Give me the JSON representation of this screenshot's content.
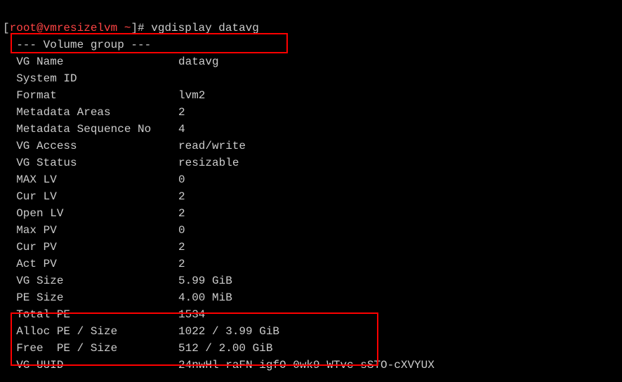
{
  "prompt": {
    "open": "[",
    "user_host": "root@vmresizelvm ~",
    "close": "]# ",
    "command": "vgdisplay datavg"
  },
  "header": "  --- Volume group ---",
  "rows": [
    {
      "label": "  VG Name",
      "value": "datavg"
    },
    {
      "label": "  System ID",
      "value": ""
    },
    {
      "label": "  Format",
      "value": "lvm2"
    },
    {
      "label": "  Metadata Areas",
      "value": "2"
    },
    {
      "label": "  Metadata Sequence No",
      "value": "4"
    },
    {
      "label": "  VG Access",
      "value": "read/write"
    },
    {
      "label": "  VG Status",
      "value": "resizable"
    },
    {
      "label": "  MAX LV",
      "value": "0"
    },
    {
      "label": "  Cur LV",
      "value": "2"
    },
    {
      "label": "  Open LV",
      "value": "2"
    },
    {
      "label": "  Max PV",
      "value": "0"
    },
    {
      "label": "  Cur PV",
      "value": "2"
    },
    {
      "label": "  Act PV",
      "value": "2"
    },
    {
      "label": "  VG Size",
      "value": "5.99 GiB"
    },
    {
      "label": "  PE Size",
      "value": "4.00 MiB"
    },
    {
      "label": "  Total PE",
      "value": "1534"
    },
    {
      "label": "  Alloc PE / Size",
      "value": "1022 / 3.99 GiB"
    },
    {
      "label": "  Free  PE / Size",
      "value": "512 / 2.00 GiB"
    },
    {
      "label": "  VG UUID",
      "value": "24nwHl-raFN-igfO-0wk9-WTvc-sSTO-cXVYUX"
    }
  ]
}
